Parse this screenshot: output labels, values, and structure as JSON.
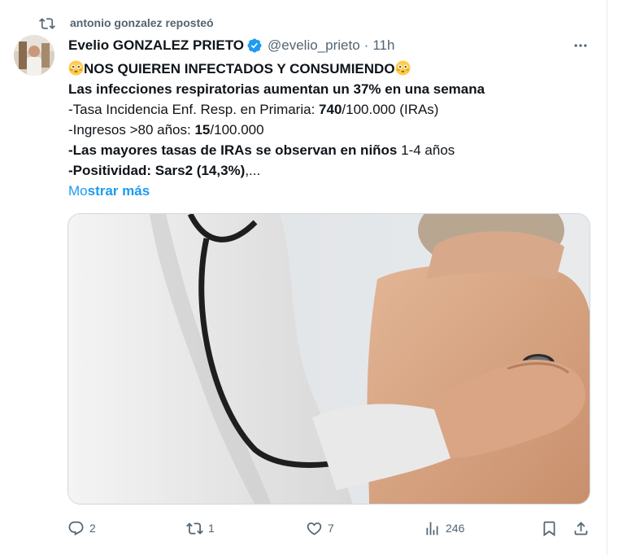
{
  "repost": {
    "text": "antonio gonzalez reposteó"
  },
  "tweet": {
    "author_name": "Evelio GONZALEZ PRIETO",
    "handle": "@evelio_prieto",
    "separator": "·",
    "time": "11h",
    "lines": {
      "l1_text": "NOS QUIEREN INFECTADOS Y CONSUMIENDO",
      "l2_text": "Las infecciones respiratorias aumentan un 37% en una semana",
      "l3_pre": "-Tasa Incidencia Enf. Resp. en Primaria: ",
      "l3_bold": "740",
      "l3_post": "/100.000 (IRAs)",
      "l4_pre": "-Ingresos >80 años: ",
      "l4_bold": "15",
      "l4_post": "/100.000",
      "l5_bold": "-Las mayores tasas de IRAs se observan en niños",
      "l5_post": " 1-4 años",
      "l6_pre": "-",
      "l6_bold": "Positividad: Sars2 (14,3%)",
      "l6_post": ",..."
    },
    "show_more_pre": "Mo",
    "show_more_bold": "strar más"
  },
  "actions": {
    "reply_count": "2",
    "retweet_count": "1",
    "like_count": "7",
    "views_count": "246"
  },
  "colors": {
    "accent": "#1d9bf0",
    "secondary_text": "#536471",
    "primary_text": "#0f1419"
  },
  "icons": {
    "repost": "retweet-icon",
    "verified": "verified-badge-icon",
    "more": "more-dots-icon",
    "reply": "reply-icon",
    "retweet": "retweet-icon",
    "like": "heart-icon",
    "views": "views-icon",
    "bookmark": "bookmark-icon",
    "share": "share-icon"
  }
}
